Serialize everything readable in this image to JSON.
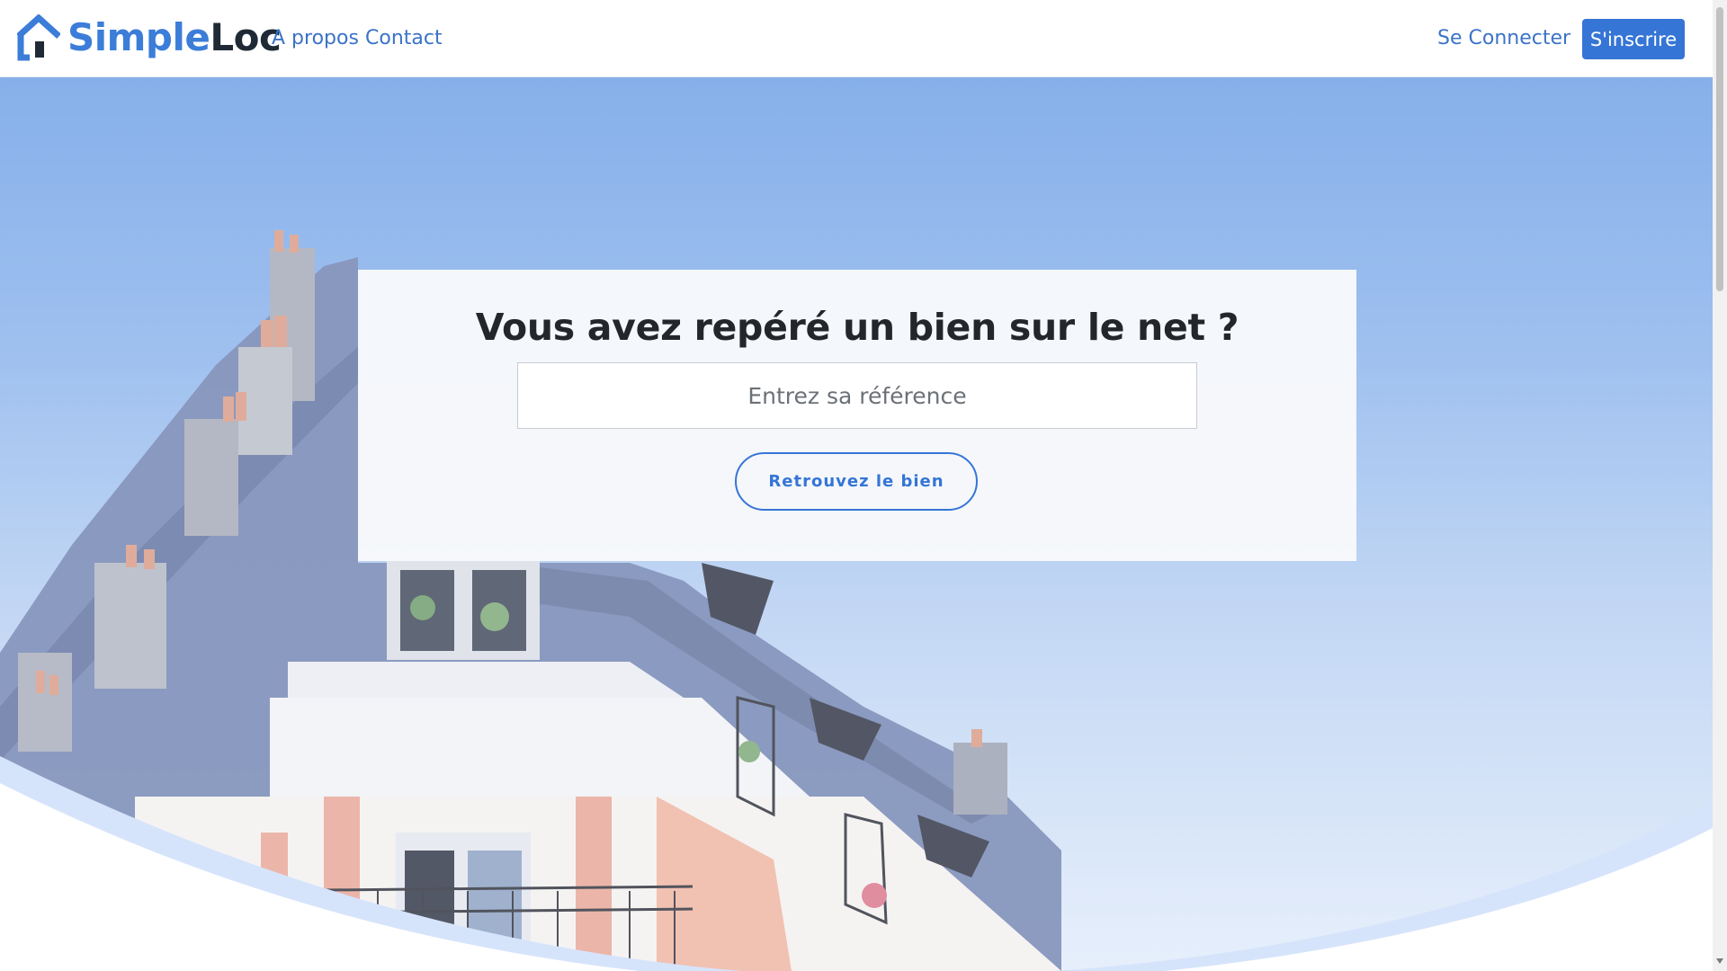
{
  "brand": {
    "part1": "Simple",
    "part2": "Loc"
  },
  "nav": {
    "apropos": "A propos",
    "contact": "Contact",
    "login": "Se Connecter",
    "signup": "S'inscrire"
  },
  "hero": {
    "title": "Vous avez repéré un bien sur le net ?",
    "input_placeholder": "Entrez sa référence",
    "input_value": "",
    "button_label": "Retrouvez le bien"
  },
  "colors": {
    "brand_blue": "#3b7dd8",
    "brand_dark": "#1f2a36",
    "primary": "#3575d6",
    "hero_sky_top": "#6c9fe6"
  },
  "icons": {
    "logo": "house-icon",
    "scroll_down": "chevron-down-icon"
  }
}
